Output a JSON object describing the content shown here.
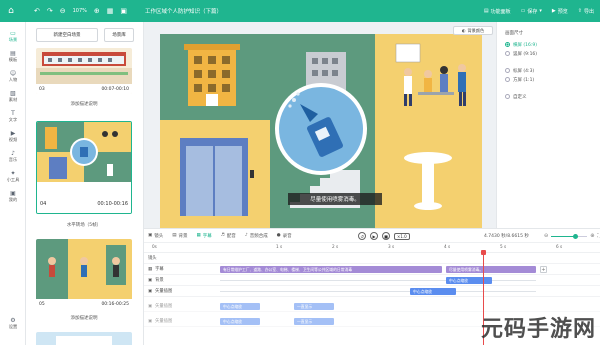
{
  "topbar": {
    "zoom": "107%",
    "title": "工作区域个人防护知识（下篇）",
    "right_buttons": [
      {
        "label": "功能面板",
        "icon": "panel-icon"
      },
      {
        "label": "保存",
        "icon": "save-icon"
      },
      {
        "label": "预览",
        "icon": "preview-icon"
      },
      {
        "label": "导出",
        "icon": "export-icon"
      }
    ]
  },
  "leftnav": [
    {
      "label": "场景",
      "icon": "scene-icon"
    },
    {
      "label": "模板",
      "icon": "template-icon"
    },
    {
      "label": "人物",
      "icon": "person-icon"
    },
    {
      "label": "素材",
      "icon": "material-icon"
    },
    {
      "label": "文字",
      "icon": "text-icon"
    },
    {
      "label": "视频",
      "icon": "video-icon"
    },
    {
      "label": "音乐",
      "icon": "music-icon"
    },
    {
      "label": "小工具",
      "icon": "tools-icon"
    },
    {
      "label": "我的",
      "icon": "mine-icon"
    },
    {
      "label": "设置",
      "icon": "settings-icon"
    }
  ],
  "scenes": {
    "new_blank": "新建空白场景",
    "scene_lib": "场景库",
    "items": [
      {
        "num": "03",
        "time": "00:07-00:10",
        "label": "添加描述说明"
      },
      {
        "num": "04",
        "time": "00:10-00:16",
        "label": "水平转场（5帧）"
      },
      {
        "num": "05",
        "time": "00:16-00:25",
        "label": "添加描述说明"
      }
    ]
  },
  "stage": {
    "bg_button": "背景颜色",
    "subtitle": "尽量使用喷雾消毒。"
  },
  "props": {
    "title": "画面尺寸",
    "options": [
      {
        "label": "横屏 (16:9)",
        "selected": true
      },
      {
        "label": "竖屏 (9:16)",
        "selected": false
      },
      {
        "label": "标屏 (4:3)",
        "selected": false
      },
      {
        "label": "方屏 (1:1)",
        "selected": false
      },
      {
        "label": "自定义",
        "selected": false
      }
    ]
  },
  "timeline": {
    "toolbar": [
      {
        "label": "镜头",
        "icon": "camera-icon",
        "active": false
      },
      {
        "label": "背景",
        "icon": "background-icon",
        "active": false
      },
      {
        "label": "字幕",
        "icon": "caption-icon",
        "active": true
      },
      {
        "label": "配音",
        "icon": "voice-icon",
        "active": false
      },
      {
        "label": "音频合成",
        "icon": "audio-icon",
        "active": false
      },
      {
        "label": "录音",
        "icon": "record-icon",
        "active": false
      }
    ],
    "speed": "×1.0",
    "time_display": "4.7430 秒/8.6615 秒",
    "ruler": [
      "0s",
      "1 s",
      "2 s",
      "3 s",
      "4 s",
      "5 s",
      "6 s"
    ],
    "tracks": [
      {
        "name": "镜头"
      },
      {
        "name": "字幕",
        "clips": [
          "有日常维护工厂、道路、办公室、电梯、楼梯、卫生间等公共区域的日常消毒",
          "尽量使用喷雾消毒。"
        ]
      },
      {
        "name": "背景",
        "clips": [
          "中心点缩放"
        ]
      },
      {
        "name": "矢量插图",
        "clips": [
          "中心点缩放"
        ]
      },
      {
        "name": "矢量插图",
        "clips": [
          "中心点缩放",
          "一直显示"
        ]
      },
      {
        "name": "矢量插图",
        "clips": [
          "中心点缩放",
          "一直显示"
        ]
      }
    ]
  },
  "watermark": "元码手游网",
  "colors": {
    "accent": "#1fb58f",
    "playhead": "#e84b4b",
    "caption_clip": "#a48bd6",
    "effect_clip": "#5b8def"
  }
}
